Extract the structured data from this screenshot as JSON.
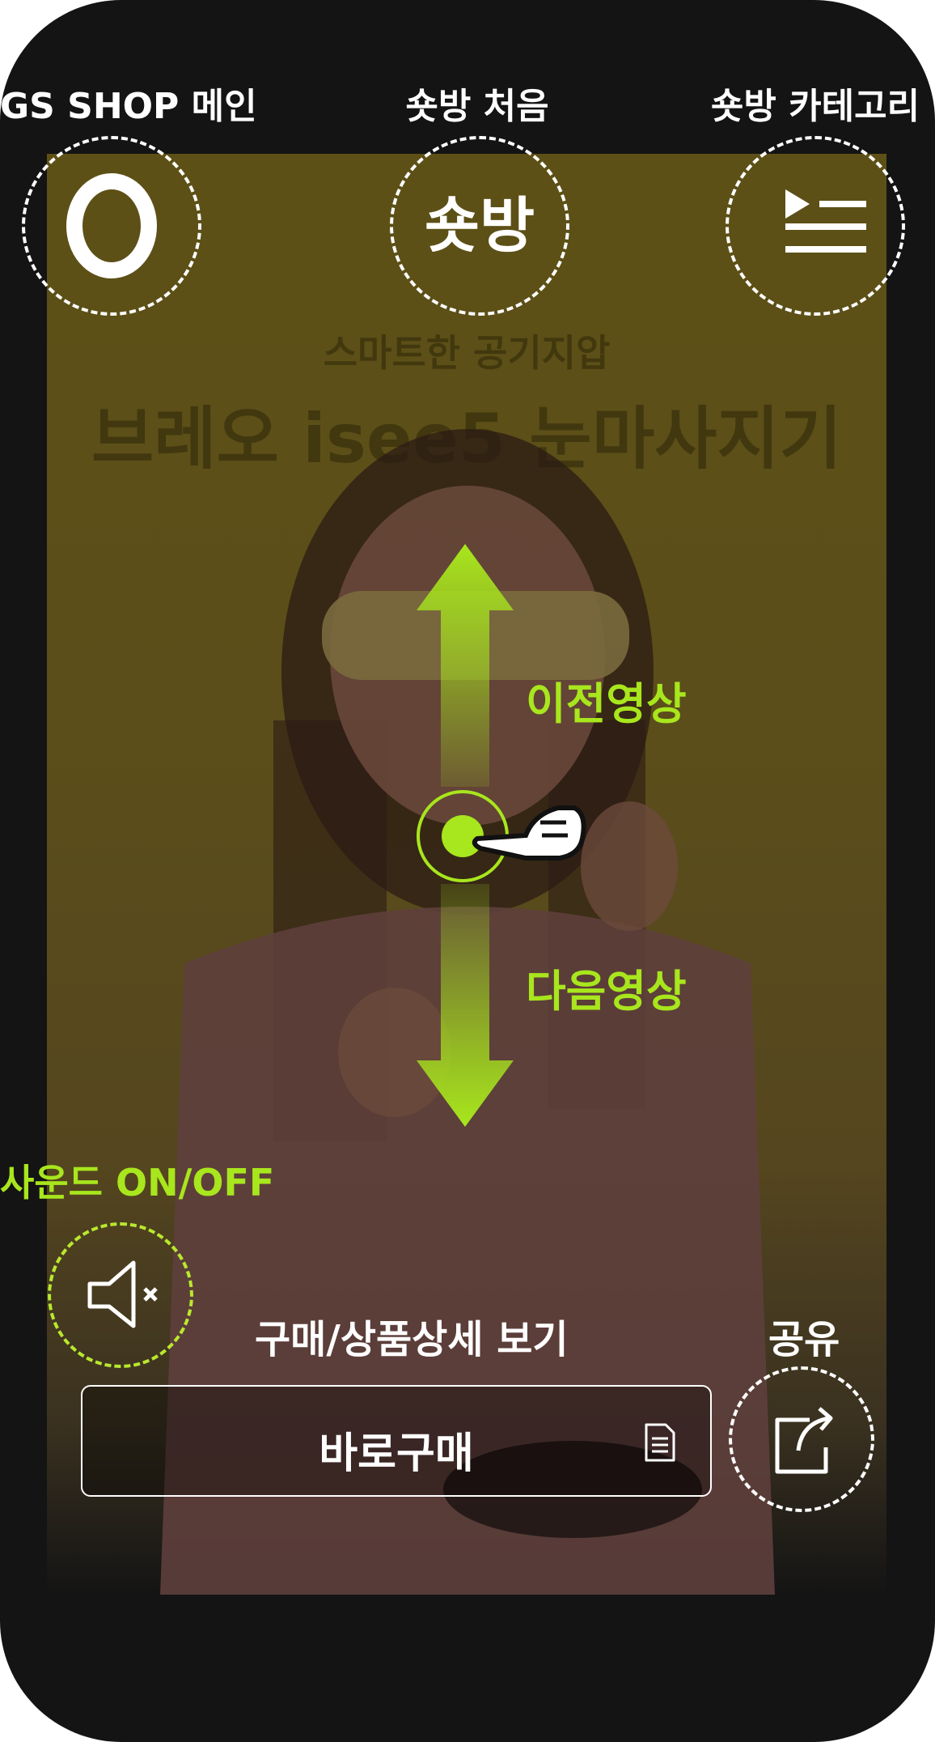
{
  "top_nav": {
    "main_label": "GS SHOP 메인",
    "first_label": "숏방 처음",
    "category_label": "숏방 카테고리",
    "shortbang_logo_text": "숏방"
  },
  "video": {
    "subtitle": "스마트한 공기지압",
    "title": "브레오 isee5 눈마사지기"
  },
  "gesture": {
    "prev_label": "이전영상",
    "next_label": "다음영상"
  },
  "sound": {
    "label": "사운드 ON/OFF"
  },
  "purchase": {
    "hint_label": "구매/상품상세 보기",
    "button_label": "바로구매"
  },
  "share": {
    "label": "공유"
  },
  "colors": {
    "accent_green": "#a8e61d",
    "background": "#141414",
    "video_tint": "#5b4e1a"
  }
}
